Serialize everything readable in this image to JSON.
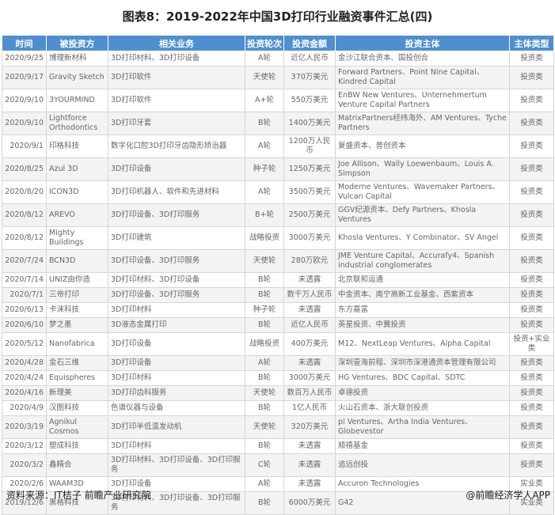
{
  "title": "图表8：2019-2022年中国3D打印行业融资事件汇总(四)",
  "columns": [
    "时间",
    "被投资方",
    "相关业务",
    "投资轮次",
    "投资金额",
    "投资主体",
    "主体类型"
  ],
  "rows": [
    [
      "2020/9/25",
      "博理新材料",
      "3D打印材料、3D打印设备",
      "A轮",
      "近亿人民币",
      "金沙江联合资本、国投创合",
      "投资类"
    ],
    [
      "2020/9/17",
      "Gravity Sketch",
      "3D打印软件",
      "天使轮",
      "370万美元",
      "Forward Partners、Point Nine Capital、Kindred Capital",
      "投资类"
    ],
    [
      "2020/9/10",
      "3YOURMIND",
      "3D打印软件",
      "A+轮",
      "550万美元",
      "EnBW New Ventures、Unternehmertum Venture Capital Partners",
      "投资类"
    ],
    [
      "2020/9/10",
      "Lightforce Orthodontics",
      "3D打印牙套",
      "B轮",
      "1400万美元",
      "MatrixPartners经纬海外、AM Ventures、Tyche Partners",
      "投资类"
    ],
    [
      "2020/9/1",
      "印格科技",
      "数字化口腔3D打印牙齿隐形矫治器",
      "A轮",
      "1200万人民币",
      "复盛资本、普创资本",
      "投资类"
    ],
    [
      "2020/8/25",
      "Azul 3D",
      "3D打印设备",
      "种子轮",
      "1250万美元",
      "Joe Allison、Wally Loewenbaum、Louis A. Simpson",
      "投资类"
    ],
    [
      "2020/8/20",
      "ICON3D",
      "3D打印机器人、软件和先进材料",
      "A轮",
      "3500万美元",
      "Moderne Ventures、Wavemaker Partners、Vulcan Capital",
      "投资类"
    ],
    [
      "2020/8/12",
      "AREVO",
      "3D打印设备、3D打印服务",
      "B+轮",
      "2500万美元",
      "GGV纪源资本、Defy Partners、Khosla Ventures",
      "投资类"
    ],
    [
      "2020/8/12",
      "Mighty Buildings",
      "3D打印建筑",
      "战略投资",
      "3000万美元",
      "Khosla Ventures、Y Combinator、SV Angel",
      "投资类"
    ],
    [
      "2020/7/24",
      "BCN3D",
      "3D打印设备、3D打印服务",
      "天使轮",
      "280万欧元",
      "JME Venture Capital、Accurafy4、Spanish industrial conglomerates",
      "投资类"
    ],
    [
      "2020/7/14",
      "UNIZ由你造",
      "3D打印材料、3D打印设备",
      "B轮",
      "未透露",
      "北京联和运通",
      "投资类"
    ],
    [
      "2020/7/1",
      "三帝打印",
      "3D打印设备、3D打印服务",
      "B轮",
      "数千万人民币",
      "中金资本、南宁高新工业基金、西紫资本",
      "投资类"
    ],
    [
      "2020/6/13",
      "卡涞科技",
      "3D打印材料",
      "种子轮",
      "未透露",
      "东方嘉富",
      "投资类"
    ],
    [
      "2020/6/10",
      "梦之墨",
      "3D液态金属打印",
      "B轮",
      "近亿人民币",
      "英星投资、中冀投资",
      "投资类"
    ],
    [
      "2020/5/12",
      "Nanofabrica",
      "3D打印设备",
      "战略投资",
      "400万美元",
      "M12、NextLeap Ventures、Alpha Capital",
      "投资+实业类"
    ],
    [
      "2020/4/28",
      "金石三维",
      "3D打印设备",
      "A轮",
      "未透露",
      "深圳壹海前程、深圳市深港通资本管理有限公司",
      "投资类"
    ],
    [
      "2020/4/24",
      "Equispheres",
      "3D打印材料",
      "B轮",
      "3000万美元",
      "HG Ventures、BDC Capital、SDTC",
      "投资类"
    ],
    [
      "2020/4/16",
      "新理美",
      "3D打印齿科服务",
      "天使轮",
      "数百万人民币",
      "卓德投资",
      "投资类"
    ],
    [
      "2020/4/9",
      "汉图科技",
      "色谱仪器与设备",
      "B轮",
      "1亿人民币",
      "火山石资本、浙大联创投资",
      "投资类"
    ],
    [
      "2020/3/19",
      "Agnikul Cosmos",
      "3D打印半低温发动机",
      "天使轮",
      "320万美元",
      "pi Ventures、Artha India Ventures、Globevestor",
      "投资类"
    ],
    [
      "2020/3/12",
      "塑成科技",
      "3D打印材料",
      "B轮",
      "未透露",
      "顺禧基金",
      "投资类"
    ],
    [
      "2020/3/2",
      "鑫精合",
      "3D打印材料、3D打印设备、3D打印服务",
      "C轮",
      "未透露",
      "追远创投",
      "投资类"
    ],
    [
      "2020/2/6",
      "WAAM3D",
      "3D打印设备",
      "A轮",
      "未透露",
      "Accuron Technologies",
      "实业类"
    ],
    [
      "2019/12/6",
      "黑格科技",
      "3D打印材料、3D打印设备、3D打印服务",
      "B轮",
      "6000万美元",
      "G42",
      "实业类"
    ]
  ],
  "footer": {
    "source": "资料来源：IT桔子 前瞻产业研究院",
    "brand": "@前瞻经济学人APP"
  }
}
